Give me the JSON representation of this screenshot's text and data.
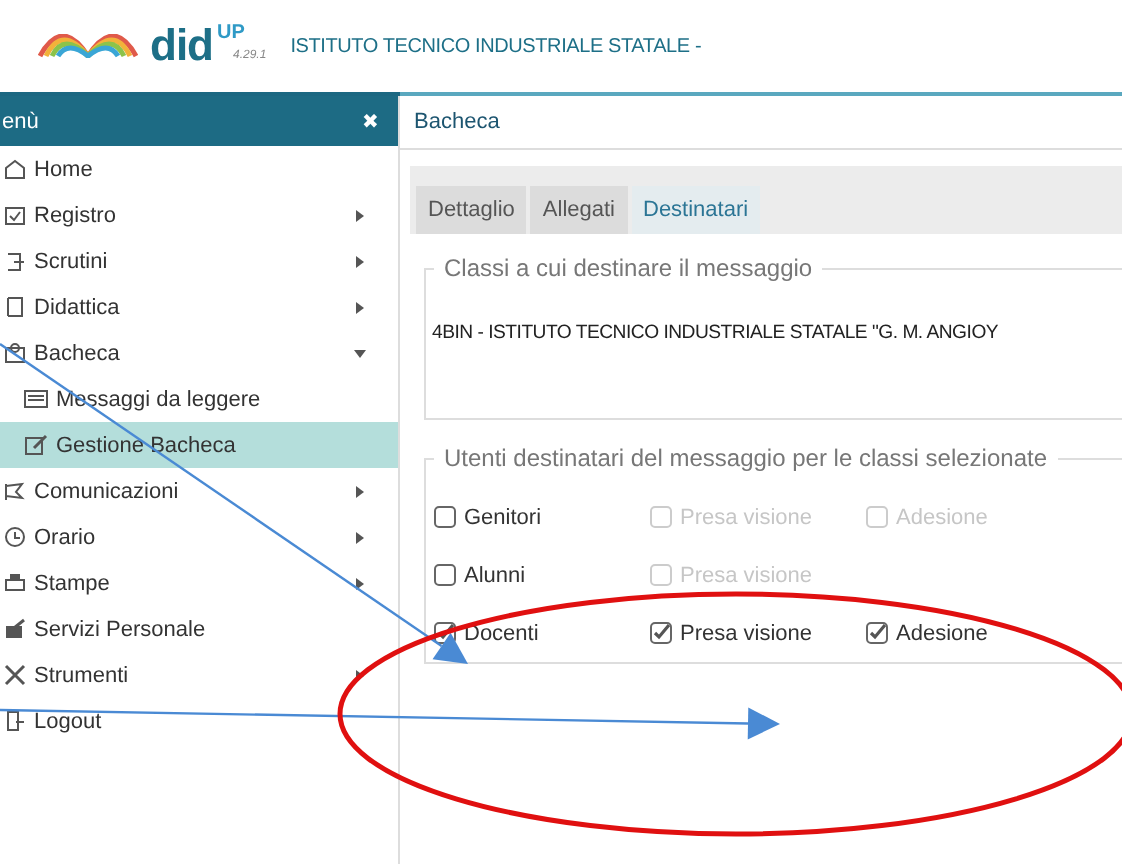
{
  "header": {
    "brand": "did",
    "brand_sup": "UP",
    "version": "4.29.1",
    "school": "ISTITUTO TECNICO INDUSTRIALE STATALE -"
  },
  "sidebar": {
    "title": "enù",
    "close": "✖",
    "items": [
      {
        "label": "Home",
        "submenu": false
      },
      {
        "label": "Registro",
        "submenu": true
      },
      {
        "label": "Scrutini",
        "submenu": true
      },
      {
        "label": "Didattica",
        "submenu": true
      },
      {
        "label": "Bacheca",
        "submenu": true,
        "expanded": true,
        "children": [
          {
            "label": "Messaggi da leggere",
            "selected": false
          },
          {
            "label": "Gestione Bacheca",
            "selected": true
          }
        ]
      },
      {
        "label": "Comunicazioni",
        "submenu": true
      },
      {
        "label": "Orario",
        "submenu": true
      },
      {
        "label": "Stampe",
        "submenu": true
      },
      {
        "label": "Servizi Personale",
        "submenu": false
      },
      {
        "label": "Strumenti",
        "submenu": true
      },
      {
        "label": "Logout",
        "submenu": false
      }
    ]
  },
  "page": {
    "title": "Bacheca",
    "tabs": [
      {
        "label": "Dettaglio",
        "selected": false
      },
      {
        "label": "Allegati",
        "selected": false
      },
      {
        "label": "Destinatari",
        "selected": true
      }
    ],
    "classes": {
      "legend": "Classi a cui destinare il messaggio",
      "value": "4BIN - ISTITUTO TECNICO INDUSTRIALE STATALE \"G. M. ANGIOY"
    },
    "recipients": {
      "legend": "Utenti destinatari del messaggio per le classi selezionate",
      "rows": [
        [
          {
            "label": "Genitori",
            "checked": false,
            "disabled": false
          },
          {
            "label": "Presa visione",
            "checked": false,
            "disabled": true
          },
          {
            "label": "Adesione",
            "checked": false,
            "disabled": true
          }
        ],
        [
          {
            "label": "Alunni",
            "checked": false,
            "disabled": false
          },
          {
            "label": "Presa visione",
            "checked": false,
            "disabled": true
          }
        ],
        [
          {
            "label": "Docenti",
            "checked": true,
            "disabled": false
          },
          {
            "label": "Presa visione",
            "checked": true,
            "disabled": false
          },
          {
            "label": "Adesione",
            "checked": true,
            "disabled": false
          }
        ]
      ]
    }
  },
  "annotations": [
    {
      "kind": "arrow",
      "color": "#4a8ad4"
    },
    {
      "kind": "arrow",
      "color": "#4a8ad4"
    },
    {
      "kind": "ellipse",
      "color": "#e01010"
    }
  ]
}
